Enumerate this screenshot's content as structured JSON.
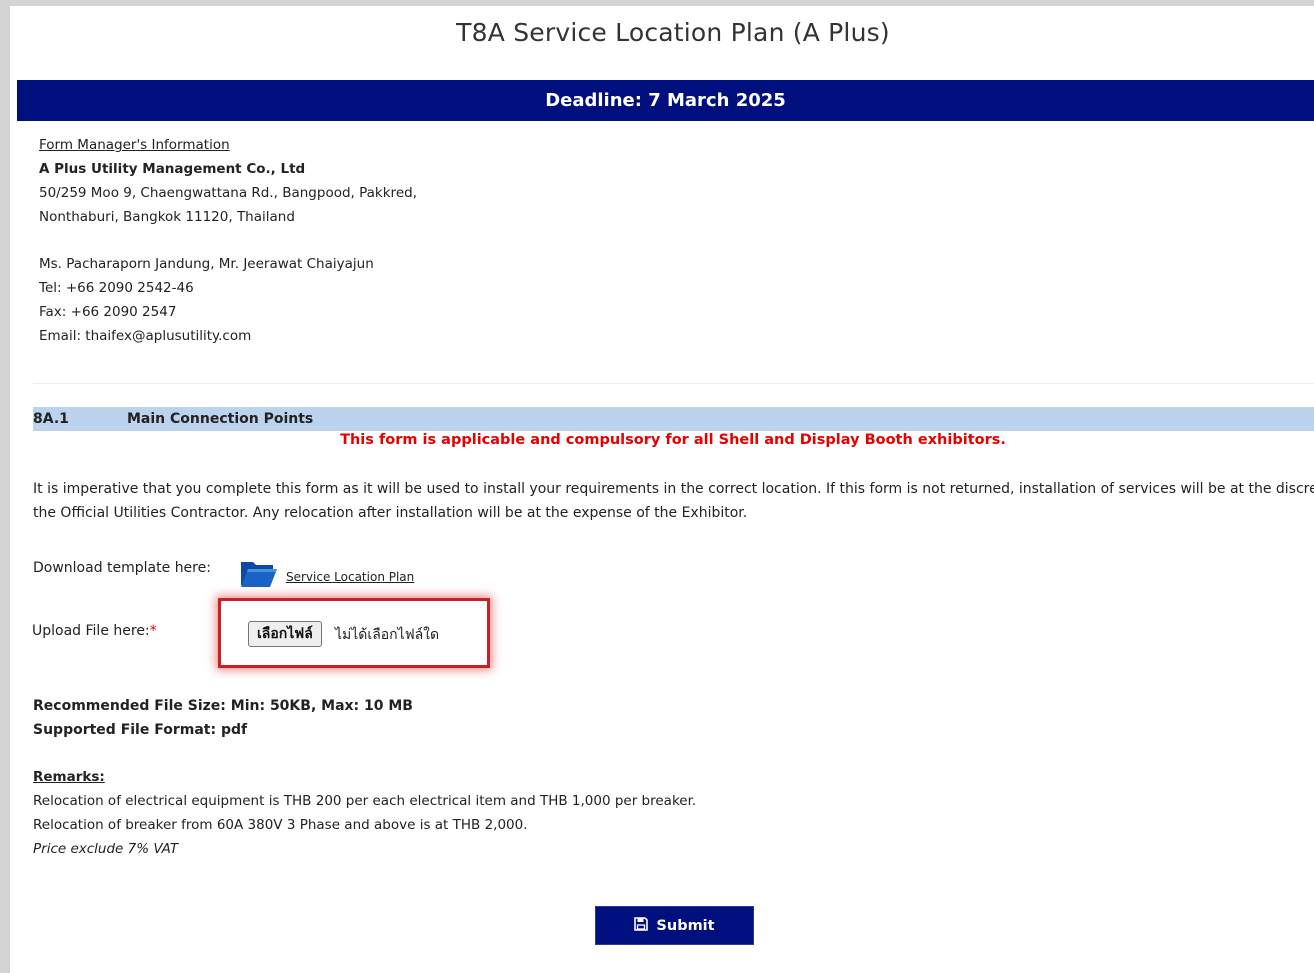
{
  "page": {
    "title": "T8A Service Location Plan (A Plus)",
    "deadline": "Deadline: 7 March 2025"
  },
  "manager": {
    "header": "Form Manager's Information",
    "company": "A Plus Utility Management Co., Ltd",
    "address_line1": "50/259 Moo 9, Chaengwattana Rd., Bangpood, Pakkred,",
    "address_line2": "Nonthaburi, Bangkok 11120, Thailand",
    "contacts": "Ms. Pacharaporn Jandung, Mr. Jeerawat Chaiyajun",
    "tel": "Tel: +66 2090 2542-46",
    "fax": "Fax: +66 2090 2547",
    "email_label": "Email: ",
    "email": "thaifex@aplusutility.com"
  },
  "section": {
    "number": "8A.1",
    "name": "Main Connection Points",
    "warning": "This form is applicable and compulsory for all Shell and Display Booth exhibitors.",
    "intro_line1": "It is imperative that you complete this form as it will be used to install your requirements in the correct location. If this form is not returned, installation of services will be at the discretion of",
    "intro_line2": "the Official Utilities Contractor. Any relocation after installation will be at the expense of the Exhibitor."
  },
  "download": {
    "label": "Download template here:",
    "link_text": "Service Location Plan",
    "icon": "folder-icon"
  },
  "upload": {
    "label": "Upload File here:",
    "required_mark": "*",
    "button_label": "เลือกไฟล์",
    "status": "ไม่ได้เลือกไฟล์ใด"
  },
  "file_info": {
    "size": "Recommended File Size: Min: 50KB, Max: 10 MB",
    "format": "Supported File Format: pdf"
  },
  "remarks": {
    "header": "Remarks:",
    "line1": "Relocation of electrical equipment is THB 200 per each electrical item and THB 1,000 per breaker.",
    "line2": "Relocation of breaker from 60A 380V 3 Phase and above is at THB 2,000.",
    "note": "Price exclude 7% VAT"
  },
  "submit": {
    "label": "Submit",
    "icon": "save-icon"
  },
  "colors": {
    "brand_navy": "#000f7e",
    "section_blue": "#bcd3ee",
    "warning_red": "#e60000",
    "highlight_red": "#cc1f1f",
    "folder_blue": "#1a63c6"
  }
}
